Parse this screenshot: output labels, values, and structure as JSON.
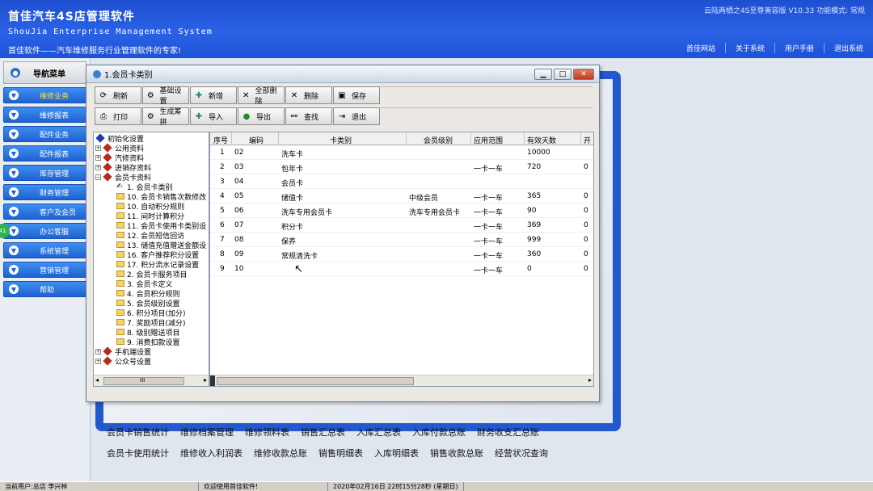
{
  "header": {
    "title": "首佳汽车4S店管理软件",
    "subtitle": "ShouJia Enterprise Management System",
    "slogan": "首佳软件——汽车维修服务行业管理软件的专家!",
    "info": "云陆两栖之4S至尊美容版  V10.33  功能模式: 常规",
    "toplinks": [
      "首佳网站",
      "关于系统",
      "用户手册",
      "退出系统"
    ]
  },
  "nav": {
    "title": "导航菜单",
    "items": [
      "维修业务",
      "维修报表",
      "配件业务",
      "配件报表",
      "库存管理",
      "财务管理",
      "客户及会员",
      "办公客服",
      "系统管理",
      "营销管理",
      "帮助"
    ],
    "badge": "41"
  },
  "dialog": {
    "title": "1.会员卡类别",
    "toolbar_row1": [
      "刷新",
      "基础设置",
      "新增",
      "全部删除",
      "删除",
      "保存"
    ],
    "toolbar_row2": [
      "打印",
      "生成筹拼",
      "导入",
      "导出",
      "查找",
      "退出"
    ],
    "tree": [
      {
        "label": "初始化设置",
        "level": 0,
        "kind": "root"
      },
      {
        "label": "公用资料",
        "level": 0,
        "kind": "group"
      },
      {
        "label": "汽修资料",
        "level": 0,
        "kind": "group"
      },
      {
        "label": "进销存资料",
        "level": 0,
        "kind": "group"
      },
      {
        "label": "会员卡资料",
        "level": 0,
        "kind": "group-open"
      },
      {
        "label": "1. 会员卡类别",
        "level": 1,
        "kind": "current"
      },
      {
        "label": "10. 会员卡销售次数修改",
        "level": 1,
        "kind": "folder"
      },
      {
        "label": "10. 自动积分规则",
        "level": 1,
        "kind": "folder"
      },
      {
        "label": "11. 间时计算积分",
        "level": 1,
        "kind": "folder"
      },
      {
        "label": "11. 会员卡使用卡类别设",
        "level": 1,
        "kind": "folder"
      },
      {
        "label": "12. 会员短信回访",
        "level": 1,
        "kind": "folder"
      },
      {
        "label": "13. 储值充值赠送金额设",
        "level": 1,
        "kind": "folder"
      },
      {
        "label": "16. 客户推荐积分设置",
        "level": 1,
        "kind": "folder"
      },
      {
        "label": "17. 积分流水记录设置",
        "level": 1,
        "kind": "folder"
      },
      {
        "label": "2. 会员卡服务项目",
        "level": 1,
        "kind": "folder"
      },
      {
        "label": "3. 会员卡定义",
        "level": 1,
        "kind": "folder"
      },
      {
        "label": "4. 会员积分规则",
        "level": 1,
        "kind": "folder"
      },
      {
        "label": "5. 会员级别设置",
        "level": 1,
        "kind": "folder"
      },
      {
        "label": "6. 积分项目(加分)",
        "level": 1,
        "kind": "folder"
      },
      {
        "label": "7. 奖励项目(减分)",
        "level": 1,
        "kind": "folder"
      },
      {
        "label": "8. 级别赠送项目",
        "level": 1,
        "kind": "folder"
      },
      {
        "label": "9. 消费扣款设置",
        "level": 1,
        "kind": "folder"
      },
      {
        "label": "手机端设置",
        "level": 0,
        "kind": "group"
      },
      {
        "label": "公众号设置",
        "level": 0,
        "kind": "group"
      }
    ],
    "tree_scroll_label": "III",
    "grid": {
      "columns": [
        "序号",
        "编码",
        "卡类别",
        "会员级别",
        "应用范围",
        "有效天数",
        "开"
      ],
      "rows": [
        [
          "1",
          "02",
          "洗车卡",
          "",
          "",
          "10000",
          ""
        ],
        [
          "2",
          "03",
          "包年卡",
          "",
          "一卡一车",
          "720",
          "0"
        ],
        [
          "3",
          "04",
          "会员卡",
          "",
          "",
          "",
          ""
        ],
        [
          "4",
          "05",
          "储值卡",
          "中级会员",
          "一卡一车",
          "365",
          "0"
        ],
        [
          "5",
          "06",
          "洗车专用会员卡",
          "洗车专用会员卡",
          "一卡一车",
          "90",
          "0"
        ],
        [
          "6",
          "07",
          "积分卡",
          "",
          "一卡一车",
          "369",
          "0"
        ],
        [
          "7",
          "08",
          "保养",
          "",
          "一卡一车",
          "999",
          "0"
        ],
        [
          "8",
          "09",
          "常规清洗卡",
          "",
          "一卡一车",
          "360",
          "0"
        ],
        [
          "9",
          "10",
          "",
          "",
          "一卡一车",
          "0",
          "0"
        ]
      ]
    }
  },
  "bottom_links": {
    "row1": [
      "会员卡销售统计",
      "维修档案管理",
      "维修领料表",
      "销售汇总表",
      "入库汇总表",
      "入库付款总账",
      "财务收支汇总账"
    ],
    "row2": [
      "会员卡使用统计",
      "维修收入利润表",
      "维修收款总账",
      "销售明细表",
      "入库明细表",
      "销售收款总账",
      "经营状况查询"
    ]
  },
  "status": {
    "user": "当前用户:总店 李兴林",
    "welcome": "欢迎使用首佳软件!",
    "datetime": "2020年02月16日 22时15分28秒 (星期日)"
  }
}
